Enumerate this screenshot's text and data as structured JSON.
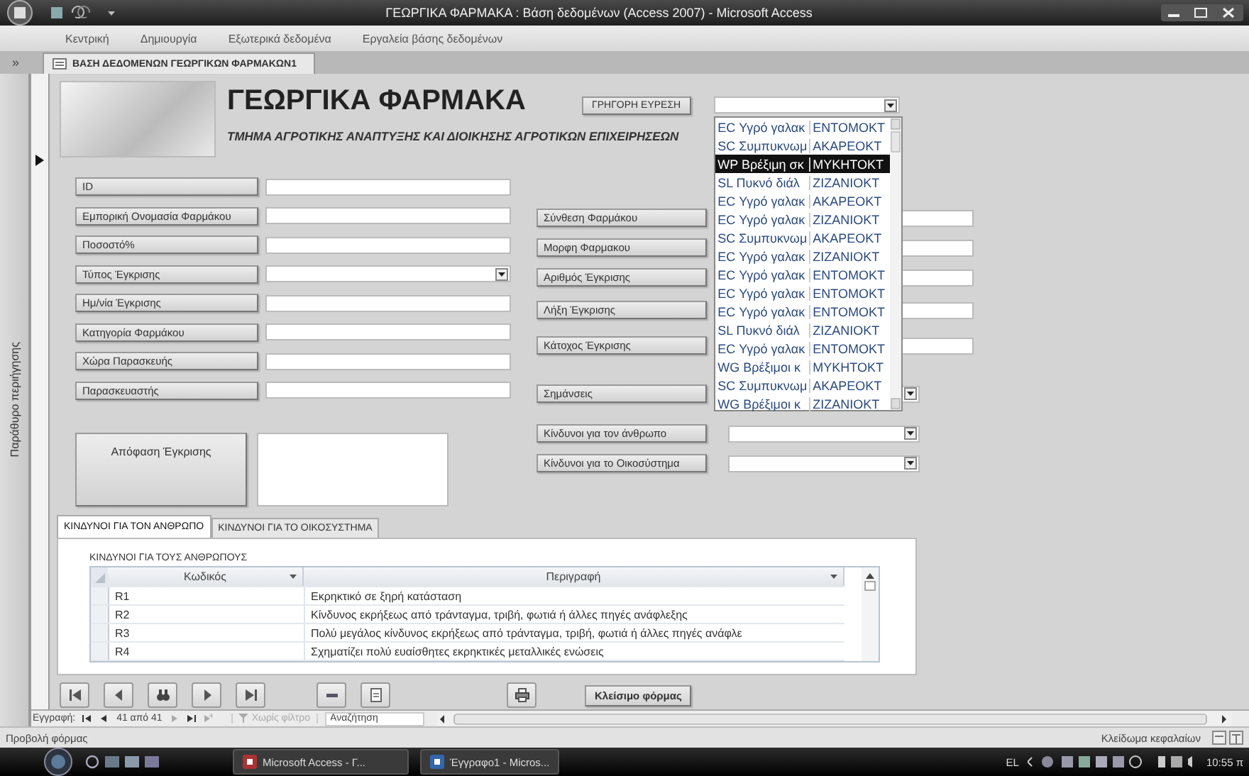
{
  "window": {
    "title": "ΓΕΩΡΓΙΚΑ ΦΑΡΜΑΚΑ : Βάση δεδομένων (Access 2007) - Microsoft Access"
  },
  "ribbon_tabs": [
    {
      "label": "Κεντρική"
    },
    {
      "label": "Δημιουργία"
    },
    {
      "label": "Εξωτερικά δεδομένα"
    },
    {
      "label": "Εργαλεία βάσης δεδομένων"
    }
  ],
  "nav_pane": {
    "toggle": "»",
    "label": "Παράθυρο περιήγησης"
  },
  "document_tab": {
    "label": "ΒΑΣΗ ΔΕΔΟΜΕΝΩΝ ΓΕΩΡΓΙΚΩΝ ΦΑΡΜΑΚΩΝ1"
  },
  "form": {
    "title": "ΓΕΩΡΓΙΚΑ ΦΑΡΜΑΚΑ",
    "subtitle": "ΤΜΗΜΑ ΑΓΡΟΤΙΚΗΣ ΑΝΑΠΤΥΞΗΣ ΚΑΙ ΔΙΟΙΚΗΣΗΣ ΑΓΡΟΤΙΚΩΝ ΕΠΙΧΕΙΡΗΣΕΩΝ",
    "quick_search": {
      "label": "ΓΡΗΓΟΡΗ ΕΥΡΕΣΗ",
      "options": [
        {
          "column_1": "EC Υγρό γαλακ",
          "column_2": "ΕΝΤΟΜΟΚΤ",
          "selected": false
        },
        {
          "column_1": "SC Συμπυκνωμ",
          "column_2": "ΑΚΑΡΕΟΚΤ",
          "selected": false
        },
        {
          "column_1": "WP Βρέξιμη σκ",
          "column_2": "ΜΥΚΗΤΟΚΤ",
          "selected": true
        },
        {
          "column_1": "SL Πυκνό διάλ",
          "column_2": "ΖΙΖΑΝΙΟΚΤ",
          "selected": false
        },
        {
          "column_1": "EC Υγρό γαλακ",
          "column_2": "ΑΚΑΡΕΟΚΤ",
          "selected": false
        },
        {
          "column_1": "EC Υγρό γαλακ",
          "column_2": "ΖΙΖΑΝΙΟΚΤ",
          "selected": false
        },
        {
          "column_1": "SC Συμπυκνωμ",
          "column_2": "ΑΚΑΡΕΟΚΤ",
          "selected": false
        },
        {
          "column_1": "EC Υγρό γαλακ",
          "column_2": "ΖΙΖΑΝΙΟΚΤ",
          "selected": false
        },
        {
          "column_1": "EC Υγρό γαλακ",
          "column_2": "ΕΝΤΟΜΟΚΤ",
          "selected": false
        },
        {
          "column_1": "EC Υγρό γαλακ",
          "column_2": "ΕΝΤΟΜΟΚΤ",
          "selected": false
        },
        {
          "column_1": "EC Υγρό γαλακ",
          "column_2": "ΕΝΤΟΜΟΚΤ",
          "selected": false
        },
        {
          "column_1": "SL Πυκνό διάλ",
          "column_2": "ΖΙΖΑΝΙΟΚΤ",
          "selected": false
        },
        {
          "column_1": "EC Υγρό γαλακ",
          "column_2": "ΕΝΤΟΜΟΚΤ",
          "selected": false
        },
        {
          "column_1": "WG Βρέξιμοι κ",
          "column_2": "ΜΥΚΗΤΟΚΤ",
          "selected": false
        },
        {
          "column_1": "SC Συμπυκνωμ",
          "column_2": "ΑΚΑΡΕΟΚΤ",
          "selected": false
        },
        {
          "column_1": "WG Βρέξιμοι κ",
          "column_2": "ΖΙΖΑΝΙΟΚΤ",
          "selected": false
        }
      ]
    },
    "left_fields": [
      {
        "label": "ID",
        "kind": "text"
      },
      {
        "label": "Εμπορική Ονομασία Φαρμάκου",
        "kind": "text"
      },
      {
        "label": "Ποσοστό%",
        "kind": "text"
      },
      {
        "label": "Τύπος Έγκρισης",
        "kind": "combo"
      },
      {
        "label": "Ημ/νία Έγκρισης",
        "kind": "text"
      },
      {
        "label": "Κατηγορία Φαρμάκου",
        "kind": "text"
      },
      {
        "label": "Χώρα Παρασκευής",
        "kind": "text"
      },
      {
        "label": "Παρασκευαστής",
        "kind": "text"
      }
    ],
    "decision": {
      "label": "Απόφαση Έγκρισης"
    },
    "right_fields": [
      {
        "label": "Σύνθεση Φαρμάκου",
        "kind": "text"
      },
      {
        "label": "Μορφη Φαρμακου",
        "kind": "text"
      },
      {
        "label": "Αριθμός Έγκρισης",
        "kind": "text"
      },
      {
        "label": "Λήξη Έγκρισης",
        "kind": "text"
      },
      {
        "label": "Κάτοχος Έγκρισης",
        "kind": "text"
      },
      {
        "label": "Σημάνσεις",
        "kind": "combo"
      },
      {
        "label": "Κίνδυνοι για τον άνθρωπο",
        "kind": "combo"
      },
      {
        "label": "Κίνδυνοι για το Οικοσύστημα",
        "kind": "combo"
      }
    ],
    "tabs": [
      {
        "label": "ΚΙΝΔΥΝΟΙ ΓΙΑ ΤΟΝ ΑΝΘΡΩΠΟ",
        "selected": true
      },
      {
        "label": "ΚΙΝΔΥΝΟΙ ΓΙΑ ΤΟ ΟΙΚΟΣΥΣΤΗΜΑ",
        "selected": false
      }
    ],
    "subform": {
      "heading": "ΚΙΝΔΥΝΟΙ ΓΙΑ ΤΟΥΣ ΑΝΘΡΩΠΟΥΣ",
      "columns": [
        "Κωδικός",
        "Περιγραφή"
      ],
      "rows": [
        [
          "R1",
          "Εκρηκτικό σε ξηρή κατάσταση"
        ],
        [
          "R2",
          "Κίνδυνος εκρήξεως από τράνταγμα, τριβή, φωτιά ή άλλες πηγές ανάφλεξης"
        ],
        [
          "R3",
          "Πολύ μεγάλος κίνδυνος εκρήξεως από τράνταγμα, τριβή, φωτιά ή άλλες πηγές ανάφλε"
        ],
        [
          "R4",
          "Σχηματίζει πολύ ευαίσθητες εκρηκτικές μεταλλικές ενώσεις"
        ]
      ]
    },
    "close_button": "Κλείσιμο φόρμας"
  },
  "record_nav": {
    "label": "Εγγραφή:",
    "position": "41 από 41",
    "filter": "Χωρίς φίλτρο",
    "search_placeholder": "Αναζήτηση"
  },
  "status_bar": {
    "left": "Προβολή φόρμας",
    "right": "Κλείδωμα κεφαλαίων"
  },
  "taskbar": {
    "tasks": [
      {
        "label": "Microsoft Access - Γ..."
      },
      {
        "label": "Έγγραφο1 - Micros..."
      }
    ],
    "language": "EL",
    "clock": "10:55 π"
  }
}
